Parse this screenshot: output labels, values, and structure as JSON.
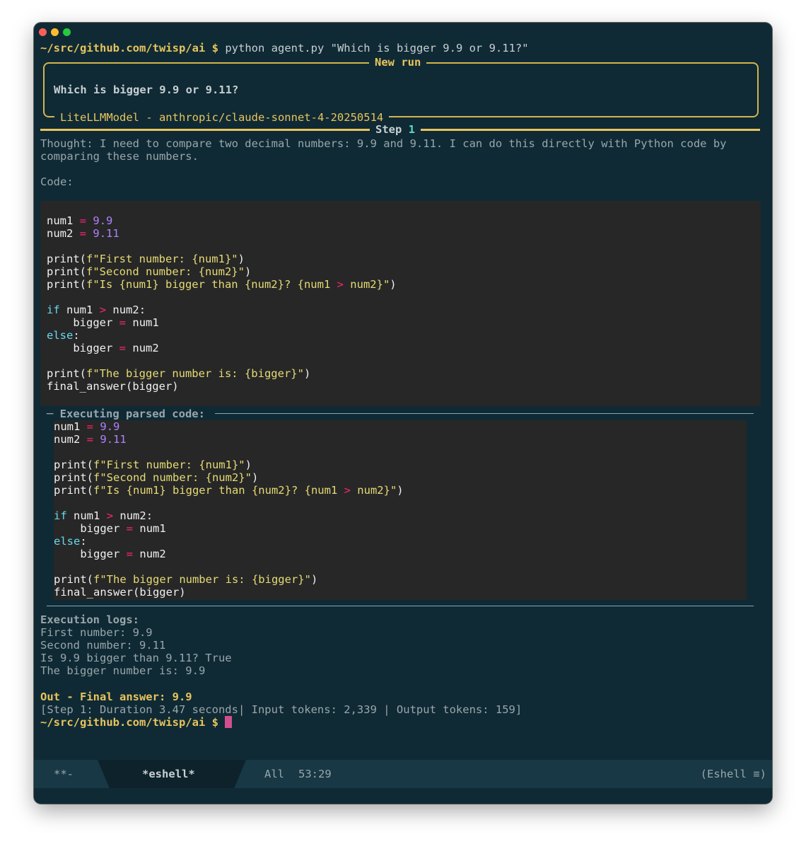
{
  "window": {
    "traffic_lights": [
      "close",
      "minimize",
      "zoom"
    ]
  },
  "prompt": {
    "path": "~/src/github.com/twisp/ai",
    "symbol": "$",
    "command": "python agent.py \"Which is bigger 9.9 or 9.11?\""
  },
  "new_run": {
    "title": "New run",
    "task": "Which is bigger 9.9 or 9.11?",
    "model": "LiteLLMModel - anthropic/claude-sonnet-4-20250514"
  },
  "step": {
    "label": "Step",
    "number": "1"
  },
  "thought": {
    "line1": "Thought: I need to compare two decimal numbers: 9.9 and 9.11. I can do this directly with Python code by",
    "line2": "comparing these numbers.",
    "code_label": "Code:"
  },
  "code": {
    "var1": "num1",
    "val1": "9.9",
    "var2": "num2",
    "val2": "9.11",
    "eq": "=",
    "gt": ">",
    "print": "print(",
    "print_close": ")",
    "str_first": "f\"First number: {num1}\"",
    "str_second": "f\"Second number: {num2}\"",
    "str_is_a": "f\"Is {num1} bigger than {num2}? {num1 ",
    "str_is_b": " num2}\"",
    "kw_if": "if",
    "kw_else": "else",
    "colon": ":",
    "bigger": "bigger",
    "str_bigger": "f\"The bigger number is: {bigger}\"",
    "final": "final_answer(bigger)"
  },
  "executing": {
    "header": "─ Executing parsed code: "
  },
  "logs": {
    "header": "Execution logs:",
    "lines": [
      "First number: 9.9",
      "Second number: 9.11",
      "Is 9.9 bigger than 9.11? True",
      "The bigger number is: 9.9"
    ]
  },
  "final_answer": "Out - Final answer: 9.9",
  "stats": "[Step 1: Duration 3.47 seconds| Input tokens: 2,339 | Output tokens: 159]",
  "modeline": {
    "left": "**-",
    "buffer": "*eshell*",
    "position": "All",
    "linecol": "53:29",
    "mode": "(Eshell ≡)"
  }
}
